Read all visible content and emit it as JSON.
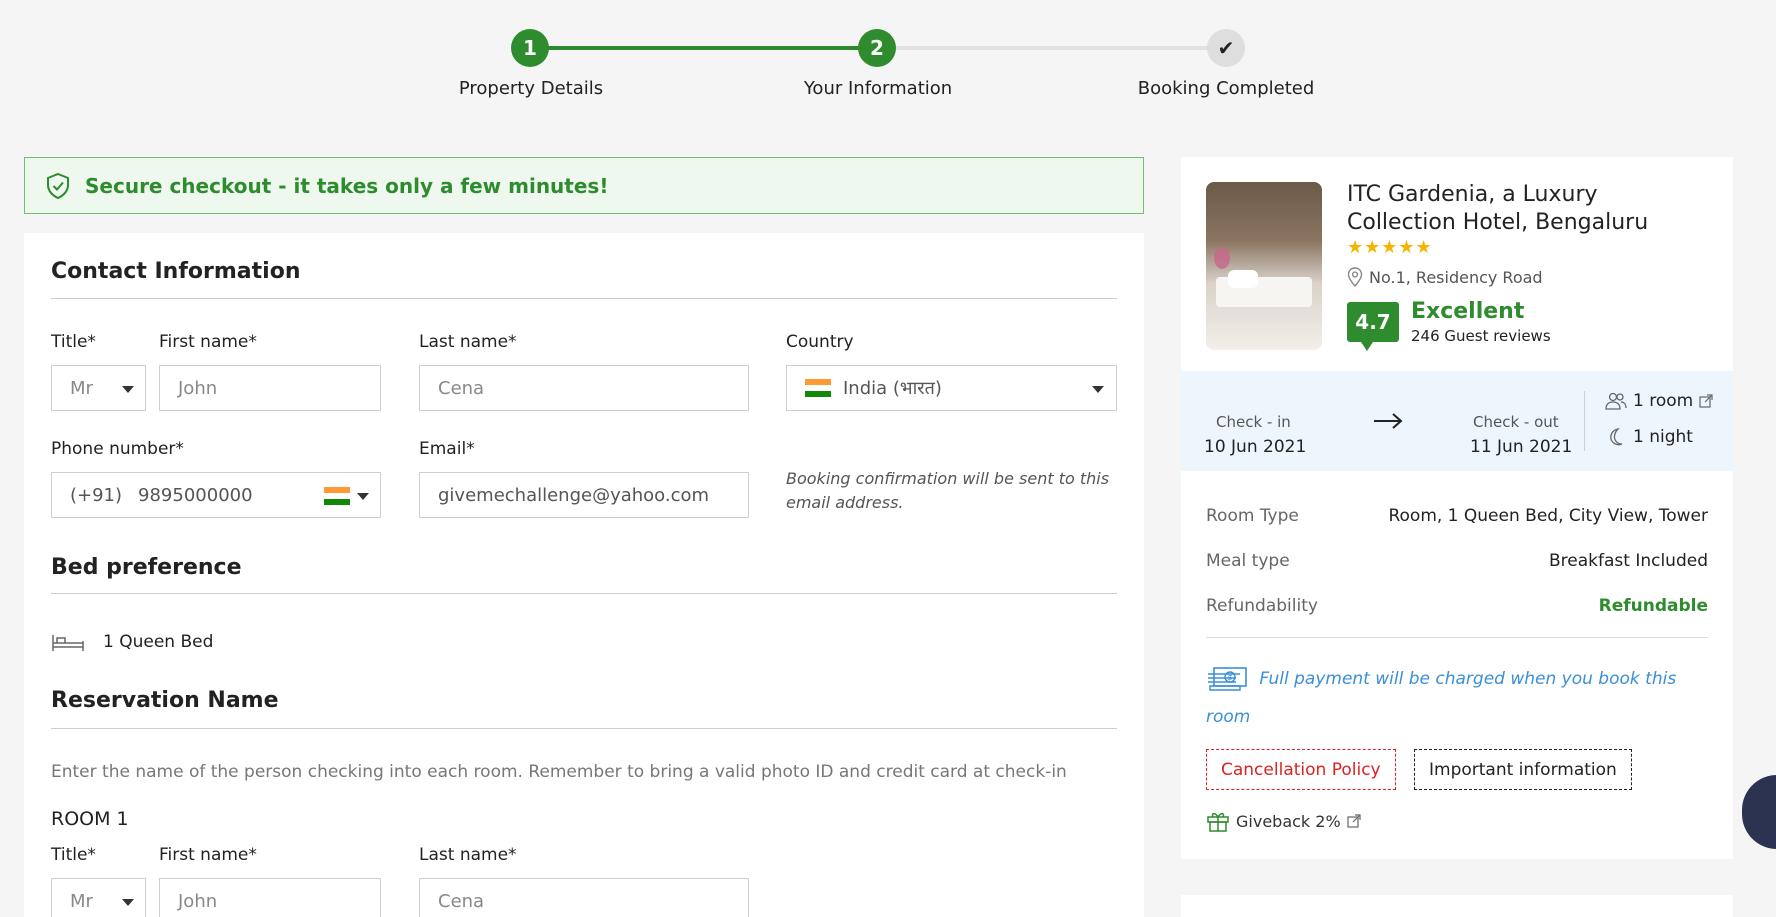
{
  "stepper": {
    "steps": [
      {
        "number": "1",
        "label": "Property Details"
      },
      {
        "number": "2",
        "label": "Your Information"
      },
      {
        "number": "✔",
        "label": "Booking Completed"
      }
    ]
  },
  "secure_banner": "Secure checkout - it takes only a few minutes!",
  "contact": {
    "title": "Contact Information",
    "title_label": "Title*",
    "title_value": "Mr",
    "first_name_label": "First name*",
    "first_name_placeholder": "John",
    "last_name_label": "Last name*",
    "last_name_placeholder": "Cena",
    "country_label": "Country",
    "country_value": "India (भारत)",
    "phone_label": "Phone number*",
    "phone_code": "(+91)",
    "phone_value": "9895000000",
    "email_label": "Email*",
    "email_value": "givemechallenge@yahoo.com",
    "email_hint": "Booking confirmation will be sent to this email address."
  },
  "bed": {
    "title": "Bed preference",
    "option": "1 Queen Bed"
  },
  "reservation": {
    "title": "Reservation Name",
    "note": "Enter the name of the person checking into each room. Remember to bring a valid photo ID and credit card at check-in",
    "room_label": "ROOM 1",
    "title_label": "Title*",
    "title_value": "Mr",
    "first_name_label": "First name*",
    "first_name_placeholder": "John",
    "last_name_label": "Last name*",
    "last_name_placeholder": "Cena"
  },
  "hotel": {
    "name": "ITC Gardenia, a Luxury Collection Hotel, Bengaluru",
    "stars": 5,
    "stars_text": "★★★★★",
    "address": "No.1, Residency Road",
    "score": "4.7",
    "score_word": "Excellent",
    "reviews": "246 Guest reviews"
  },
  "stay": {
    "checkin_label": "Check - in",
    "checkin_date": "10 Jun 2021",
    "checkout_label": "Check - out",
    "checkout_date": "11 Jun 2021",
    "rooms": "1 room",
    "nights": "1 night"
  },
  "details": [
    {
      "key": "Room Type",
      "value": "Room, 1 Queen Bed, City View, Tower"
    },
    {
      "key": "Meal type",
      "value": "Breakfast Included"
    },
    {
      "key": "Refundability",
      "value": "Refundable"
    }
  ],
  "payment_note": "Full payment will be charged when you book this room",
  "buttons": {
    "cancellation": "Cancellation Policy",
    "important": "Important information"
  },
  "giveback": "Giveback 2%",
  "colors": {
    "accent_green": "#2e8b2e",
    "link_blue": "#3a8fd6",
    "policy_red": "#dd2222"
  }
}
